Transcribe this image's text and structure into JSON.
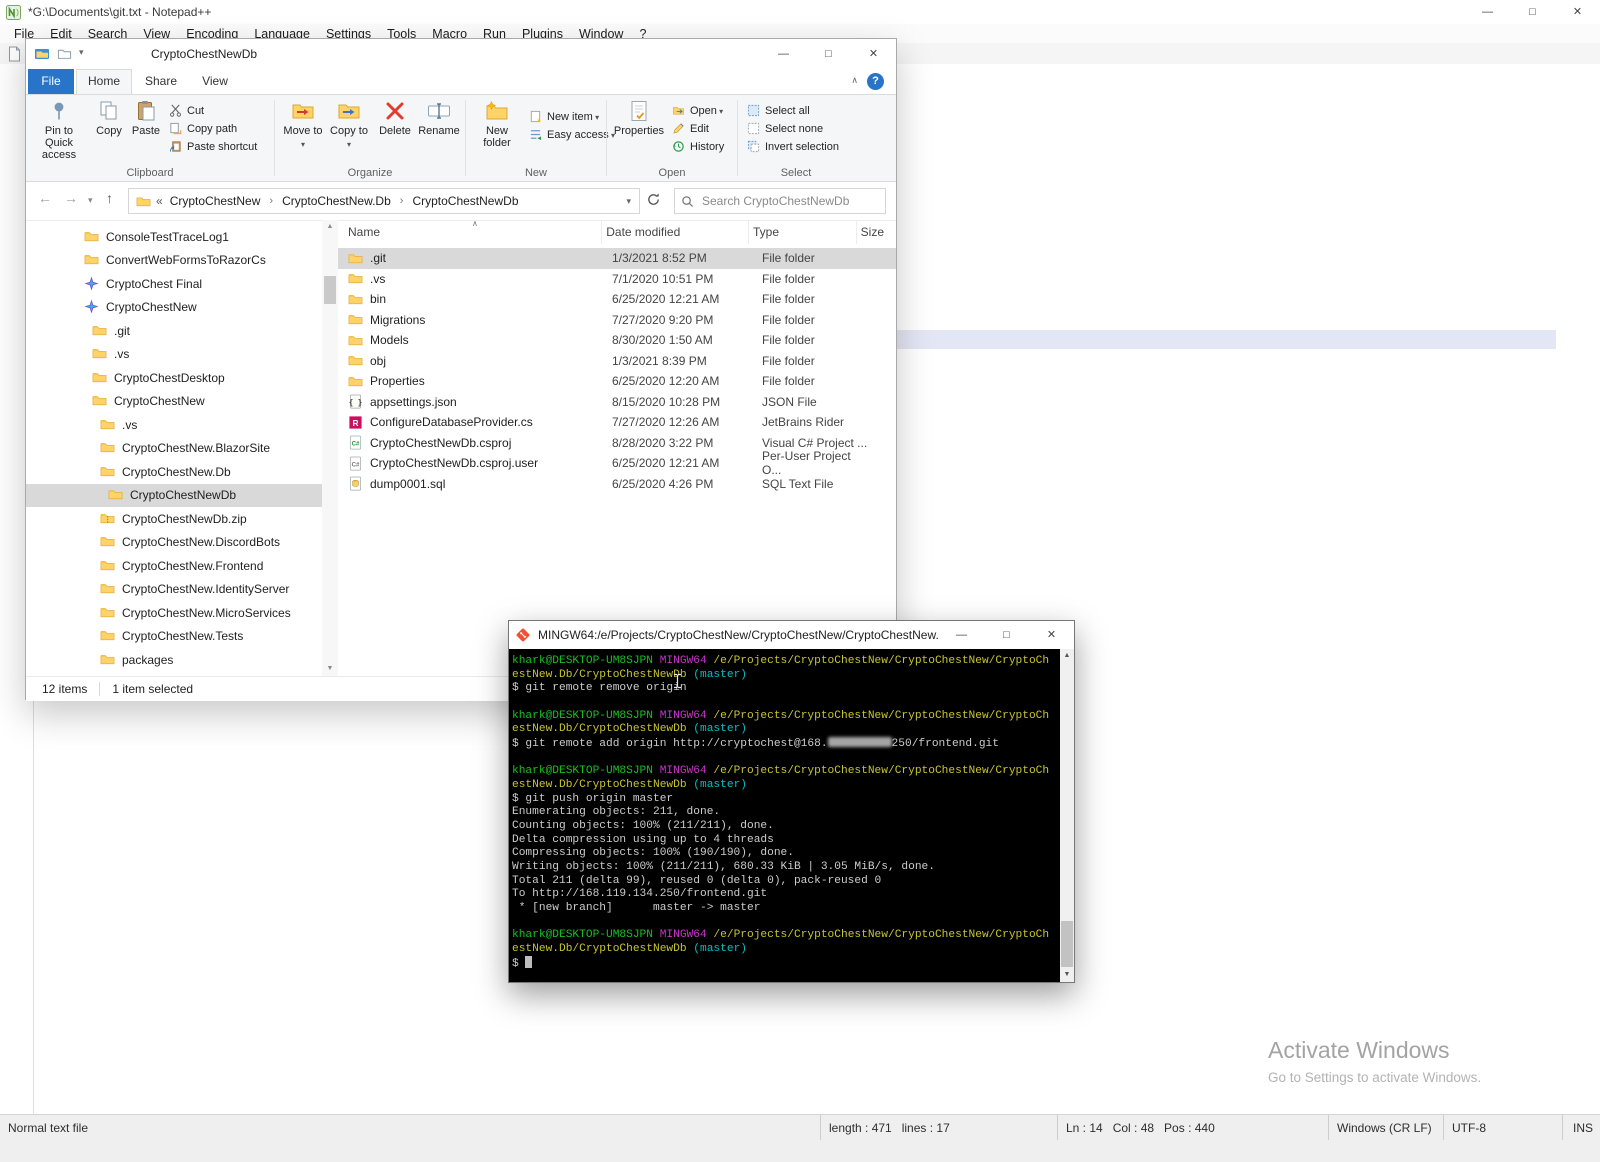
{
  "notepad": {
    "window_title": "*G:\\Documents\\git.txt - Notepad++",
    "menu": [
      "File",
      "Edit",
      "Search",
      "View",
      "Encoding",
      "Language",
      "Settings",
      "Tools",
      "Macro",
      "Run",
      "Plugins",
      "Window",
      "?"
    ],
    "status": {
      "type": "Normal text file",
      "length": "length : 471   lines : 17",
      "position": "Ln : 14   Col : 48   Pos : 440",
      "eol": "Windows (CR LF)",
      "encoding": "UTF-8",
      "insert_mode": "INS"
    }
  },
  "explorer": {
    "window_title": "CryptoChestNewDb",
    "colors": {
      "accent_blue": "#2874c8"
    },
    "tabs": [
      "File",
      "Home",
      "Share",
      "View"
    ],
    "ribbon": {
      "groups": {
        "clipboard": "Clipboard",
        "organize": "Organize",
        "new": "New",
        "open": "Open",
        "select": "Select"
      },
      "pin": "Pin to Quick access",
      "copy": "Copy",
      "paste": "Paste",
      "cut": "Cut",
      "copy_path": "Copy path",
      "paste_shortcut": "Paste shortcut",
      "move_to": "Move to",
      "copy_to": "Copy to",
      "delete": "Delete",
      "rename": "Rename",
      "new_folder": "New folder",
      "new_item": "New item",
      "easy_access": "Easy access",
      "properties": "Properties",
      "open": "Open",
      "edit": "Edit",
      "history": "History",
      "select_all": "Select all",
      "select_none": "Select none",
      "invert_selection": "Invert selection"
    },
    "address": {
      "overflow": "«",
      "separator": "›",
      "breadcrumb": [
        "CryptoChestNew",
        "CryptoChestNew.Db",
        "CryptoChestNewDb"
      ],
      "search_placeholder": "Search CryptoChestNewDb"
    },
    "tree": [
      {
        "label": "ConsoleTestTraceLog1",
        "level": 0,
        "icon": "folder"
      },
      {
        "label": "ConvertWebFormsToRazorCs",
        "level": 0,
        "icon": "folder"
      },
      {
        "label": "CryptoChest Final",
        "level": 0,
        "icon": "solution"
      },
      {
        "label": "CryptoChestNew",
        "level": 0,
        "icon": "solution"
      },
      {
        "label": ".git",
        "level": 1,
        "icon": "folder"
      },
      {
        "label": ".vs",
        "level": 1,
        "icon": "folder"
      },
      {
        "label": "CryptoChestDesktop",
        "level": 1,
        "icon": "folder"
      },
      {
        "label": "CryptoChestNew",
        "level": 1,
        "icon": "folder"
      },
      {
        "label": ".vs",
        "level": 2,
        "icon": "folder"
      },
      {
        "label": "CryptoChestNew.BlazorSite",
        "level": 2,
        "icon": "folder"
      },
      {
        "label": "CryptoChestNew.Db",
        "level": 2,
        "icon": "folder"
      },
      {
        "label": "CryptoChestNewDb",
        "level": 3,
        "icon": "folder",
        "selected": true
      },
      {
        "label": "CryptoChestNewDb.zip",
        "level": 2,
        "icon": "zip"
      },
      {
        "label": "CryptoChestNew.DiscordBots",
        "level": 2,
        "icon": "folder"
      },
      {
        "label": "CryptoChestNew.Frontend",
        "level": 2,
        "icon": "folder"
      },
      {
        "label": "CryptoChestNew.IdentityServer",
        "level": 2,
        "icon": "folder"
      },
      {
        "label": "CryptoChestNew.MicroServices",
        "level": 2,
        "icon": "folder"
      },
      {
        "label": "CryptoChestNew.Tests",
        "level": 2,
        "icon": "folder"
      },
      {
        "label": "packages",
        "level": 2,
        "icon": "folder"
      }
    ],
    "files": {
      "columns": [
        "Name",
        "Date modified",
        "Type",
        "Size"
      ],
      "rows": [
        {
          "name": ".git",
          "modified": "1/3/2021 8:52 PM",
          "type": "File folder",
          "size": "",
          "icon": "folder",
          "selected": true
        },
        {
          "name": ".vs",
          "modified": "7/1/2020 10:51 PM",
          "type": "File folder",
          "size": "",
          "icon": "folder"
        },
        {
          "name": "bin",
          "modified": "6/25/2020 12:21 AM",
          "type": "File folder",
          "size": "",
          "icon": "folder"
        },
        {
          "name": "Migrations",
          "modified": "7/27/2020 9:20 PM",
          "type": "File folder",
          "size": "",
          "icon": "folder"
        },
        {
          "name": "Models",
          "modified": "8/30/2020 1:50 AM",
          "type": "File folder",
          "size": "",
          "icon": "folder"
        },
        {
          "name": "obj",
          "modified": "1/3/2021 8:39 PM",
          "type": "File folder",
          "size": "",
          "icon": "folder"
        },
        {
          "name": "Properties",
          "modified": "6/25/2020 12:20 AM",
          "type": "File folder",
          "size": "",
          "icon": "folder"
        },
        {
          "name": "appsettings.json",
          "modified": "8/15/2020 10:28 PM",
          "type": "JSON File",
          "size": "",
          "icon": "json"
        },
        {
          "name": "ConfigureDatabaseProvider.cs",
          "modified": "7/27/2020 12:26 AM",
          "type": "JetBrains Rider",
          "size": "",
          "icon": "rider"
        },
        {
          "name": "CryptoChestNewDb.csproj",
          "modified": "8/28/2020 3:22 PM",
          "type": "Visual C# Project ...",
          "size": "",
          "icon": "csproj"
        },
        {
          "name": "CryptoChestNewDb.csproj.user",
          "modified": "6/25/2020 12:21 AM",
          "type": "Per-User Project O...",
          "size": "",
          "icon": "user"
        },
        {
          "name": "dump0001.sql",
          "modified": "6/25/2020 4:26 PM",
          "type": "SQL Text File",
          "size": "",
          "icon": "sql"
        }
      ]
    },
    "status_items": "12 items",
    "status_selected": "1 item selected"
  },
  "terminal": {
    "window_title": "MINGW64:/e/Projects/CryptoChestNew/CryptoChestNew/CryptoChestNew...",
    "colors": {
      "green": "#17c022",
      "magenta": "#c735c7",
      "yellow": "#c7c431",
      "cyan": "#00c0c0",
      "white": "#cccccc",
      "background": "#000000"
    },
    "lines": [
      [
        [
          "g",
          "khark@DESKTOP-UM8SJPN "
        ],
        [
          "m",
          "MINGW64 "
        ],
        [
          "y",
          "/e/Projects/CryptoChestNew/CryptoChestNew/CryptoCh"
        ]
      ],
      [
        [
          "y",
          "estNew.Db/CryptoChestNewDb "
        ],
        [
          "c",
          "(master)"
        ]
      ],
      [
        [
          "w",
          "$ git remote remove origin"
        ]
      ],
      [],
      [
        [
          "g",
          "khark@DESKTOP-UM8SJPN "
        ],
        [
          "m",
          "MINGW64 "
        ],
        [
          "y",
          "/e/Projects/CryptoChestNew/CryptoChestNew/CryptoCh"
        ]
      ],
      [
        [
          "y",
          "estNew.Db/CryptoChestNewDb "
        ],
        [
          "c",
          "(master)"
        ]
      ],
      [
        [
          "w",
          "$ git remote add origin http://cryptochest@168."
        ],
        [
          "r",
          ""
        ],
        [
          "w",
          "250/frontend.git"
        ]
      ],
      [],
      [
        [
          "g",
          "khark@DESKTOP-UM8SJPN "
        ],
        [
          "m",
          "MINGW64 "
        ],
        [
          "y",
          "/e/Projects/CryptoChestNew/CryptoChestNew/CryptoCh"
        ]
      ],
      [
        [
          "y",
          "estNew.Db/CryptoChestNewDb "
        ],
        [
          "c",
          "(master)"
        ]
      ],
      [
        [
          "w",
          "$ git push origin master"
        ]
      ],
      [
        [
          "w",
          "Enumerating objects: 211, done."
        ]
      ],
      [
        [
          "w",
          "Counting objects: 100% (211/211), done."
        ]
      ],
      [
        [
          "w",
          "Delta compression using up to 4 threads"
        ]
      ],
      [
        [
          "w",
          "Compressing objects: 100% (190/190), done."
        ]
      ],
      [
        [
          "w",
          "Writing objects: 100% (211/211), 680.33 KiB | 3.05 MiB/s, done."
        ]
      ],
      [
        [
          "w",
          "Total 211 (delta 99), reused 0 (delta 0), pack-reused 0"
        ]
      ],
      [
        [
          "w",
          "To http://168.119.134.250/frontend.git"
        ]
      ],
      [
        [
          "w",
          " * [new branch]      master -> master"
        ]
      ],
      [],
      [
        [
          "g",
          "khark@DESKTOP-UM8SJPN "
        ],
        [
          "m",
          "MINGW64 "
        ],
        [
          "y",
          "/e/Projects/CryptoChestNew/CryptoChestNew/CryptoCh"
        ]
      ],
      [
        [
          "y",
          "estNew.Db/CryptoChestNewDb "
        ],
        [
          "c",
          "(master)"
        ]
      ],
      [
        [
          "w",
          "$ "
        ],
        [
          "k",
          ""
        ]
      ]
    ]
  },
  "watermark": {
    "title": "Activate Windows",
    "subtitle": "Go to Settings to activate Windows."
  }
}
